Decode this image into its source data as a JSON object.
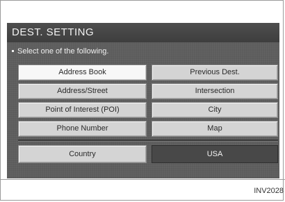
{
  "screen": {
    "title": "DEST. SETTING",
    "instruction": "Select one of the following."
  },
  "menu": {
    "address_book": "Address Book",
    "previous_dest": "Previous Dest.",
    "address_street": "Address/Street",
    "intersection": "Intersection",
    "poi": "Point of Interest (POI)",
    "city": "City",
    "phone_number": "Phone Number",
    "map": "Map"
  },
  "country": {
    "label": "Country",
    "value": "USA"
  },
  "caption": "INV2028"
}
